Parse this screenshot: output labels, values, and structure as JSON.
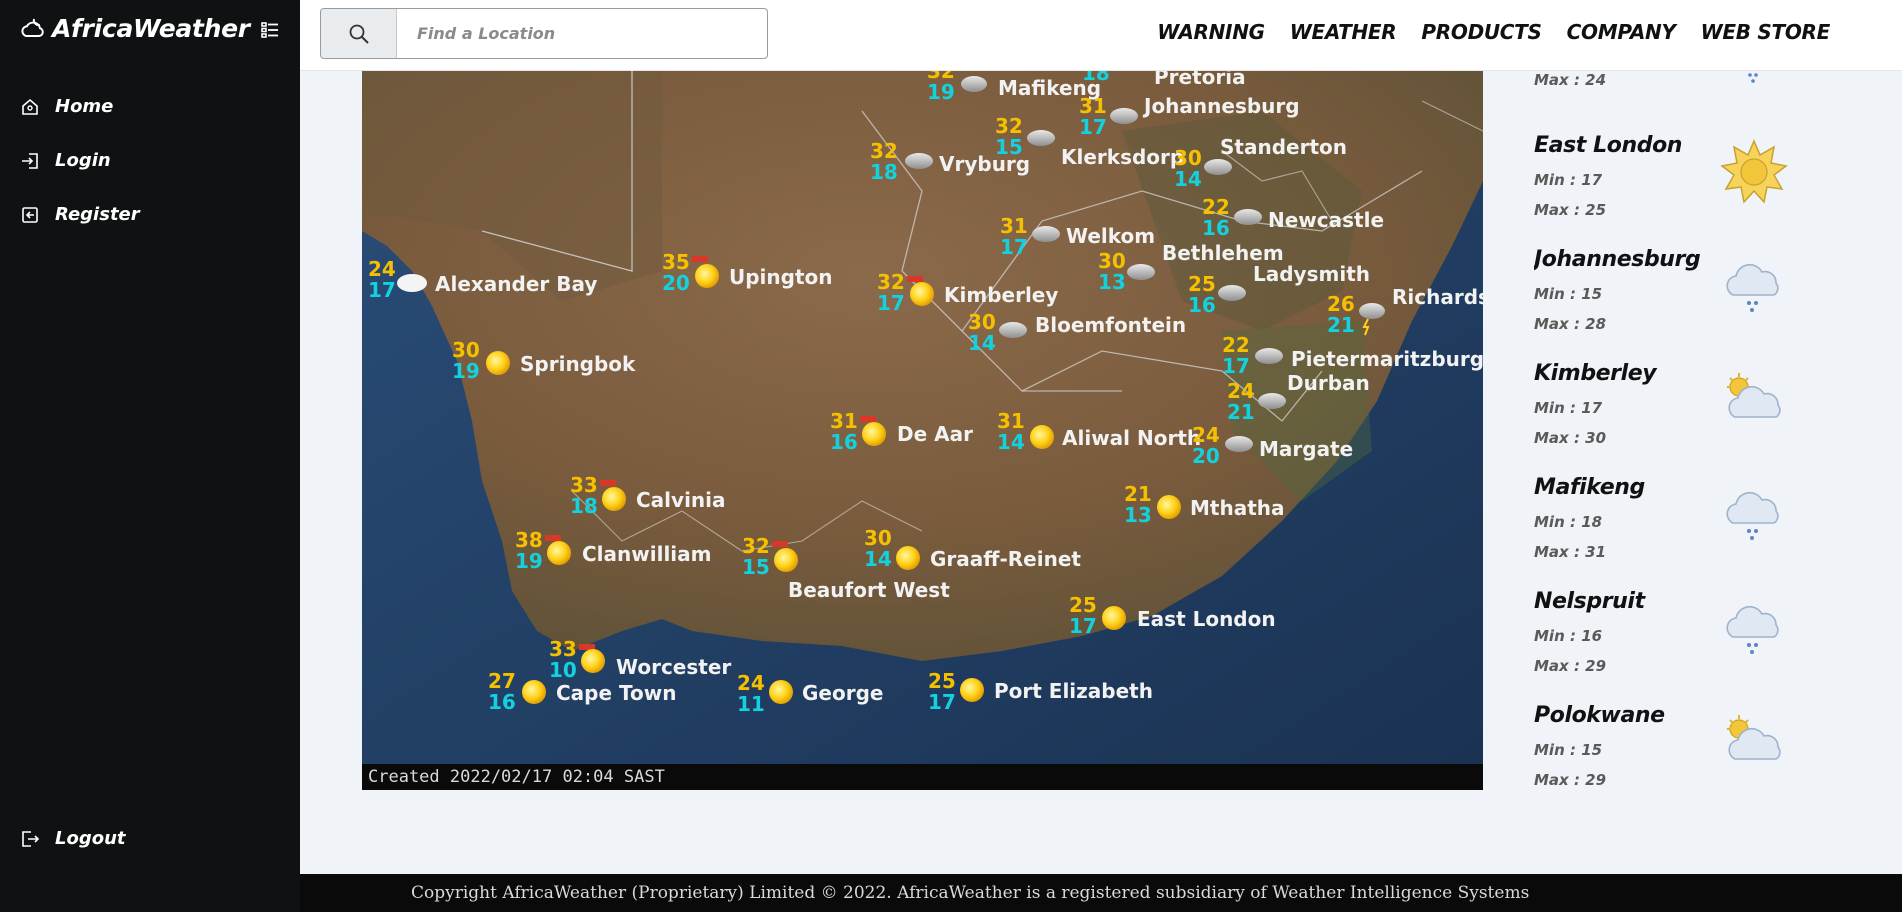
{
  "app": {
    "brand": "AfricaWeather"
  },
  "sidebar": {
    "items": [
      {
        "label": "Home",
        "icon": "home-icon"
      },
      {
        "label": "Login",
        "icon": "login-icon"
      },
      {
        "label": "Register",
        "icon": "register-icon"
      }
    ],
    "logout": {
      "label": "Logout",
      "icon": "logout-icon"
    }
  },
  "search": {
    "placeholder": "Find a Location",
    "value": ""
  },
  "topnav": [
    "WARNING",
    "WEATHER",
    "PRODUCTS",
    "COMPANY",
    "WEB STORE"
  ],
  "map": {
    "caption": "Created 2022/02/17 02:04 SAST",
    "stations": [
      {
        "name": "Mafikeng",
        "max": "32",
        "min": "19",
        "icon": "cloud-rain"
      },
      {
        "name": "Pretoria",
        "max": "",
        "min": "18",
        "icon": ""
      },
      {
        "name": "Johannesburg",
        "max": "31",
        "min": "17",
        "icon": "cloud-rain"
      },
      {
        "name": "Vryburg",
        "max": "32",
        "min": "18",
        "icon": "cloud-rain"
      },
      {
        "name": "Klerksdorp",
        "max": "32",
        "min": "15",
        "icon": "cloud-rain"
      },
      {
        "name": "Standerton",
        "max": "30",
        "min": "14",
        "icon": "cloud-rain"
      },
      {
        "name": "Newcastle",
        "max": "22",
        "min": "16",
        "icon": "cloud-rain"
      },
      {
        "name": "Welkom",
        "max": "31",
        "min": "17",
        "icon": "cloud-rain"
      },
      {
        "name": "Bethlehem",
        "max": "30",
        "min": "13",
        "icon": "cloud-rain"
      },
      {
        "name": "Ladysmith",
        "max": "25",
        "min": "16",
        "icon": "cloud-rain"
      },
      {
        "name": "Richards",
        "max": "26",
        "min": "21",
        "icon": "thunder"
      },
      {
        "name": "Alexander Bay",
        "max": "24",
        "min": "17",
        "icon": "cloud"
      },
      {
        "name": "Upington",
        "max": "35",
        "min": "20",
        "icon": "sun-hot"
      },
      {
        "name": "Kimberley",
        "max": "32",
        "min": "17",
        "icon": "sun-hot"
      },
      {
        "name": "Bloemfontein",
        "max": "30",
        "min": "14",
        "icon": "cloud-rain"
      },
      {
        "name": "Springbok",
        "max": "30",
        "min": "19",
        "icon": "sun"
      },
      {
        "name": "Pietermaritzburg",
        "max": "22",
        "min": "17",
        "icon": "cloud-rain"
      },
      {
        "name": "Durban",
        "max": "24",
        "min": "21",
        "icon": "cloud-rain"
      },
      {
        "name": "De Aar",
        "max": "31",
        "min": "16",
        "icon": "sun-hot"
      },
      {
        "name": "Aliwal North",
        "max": "31",
        "min": "14",
        "icon": "sun"
      },
      {
        "name": "Margate",
        "max": "24",
        "min": "20",
        "icon": "cloud-rain"
      },
      {
        "name": "Calvinia",
        "max": "33",
        "min": "18",
        "icon": "sun-hot"
      },
      {
        "name": "Mthatha",
        "max": "21",
        "min": "13",
        "icon": "sun"
      },
      {
        "name": "Clanwilliam",
        "max": "38",
        "min": "19",
        "icon": "sun-hot"
      },
      {
        "name": "Beaufort West",
        "max": "32",
        "min": "15",
        "icon": "sun-hot"
      },
      {
        "name": "Graaff-Reinet",
        "max": "30",
        "min": "14",
        "icon": "sun"
      },
      {
        "name": "East London",
        "max": "25",
        "min": "17",
        "icon": "sun"
      },
      {
        "name": "Worcester",
        "max": "33",
        "min": "10",
        "icon": "sun-hot"
      },
      {
        "name": "Cape Town",
        "max": "27",
        "min": "16",
        "icon": "sun"
      },
      {
        "name": "George",
        "max": "24",
        "min": "11",
        "icon": "sun"
      },
      {
        "name": "Port Elizabeth",
        "max": "25",
        "min": "17",
        "icon": "sun"
      }
    ]
  },
  "forecast": {
    "partial": {
      "max": "Max : 24",
      "icon": "drizzle-icon"
    },
    "cities": [
      {
        "name": "East London",
        "min": "Min : 17",
        "max": "Max : 25",
        "icon": "sun-icon"
      },
      {
        "name": "Johannesburg",
        "min": "Min : 15",
        "max": "Max : 28",
        "icon": "drizzle-icon"
      },
      {
        "name": "Kimberley",
        "min": "Min : 17",
        "max": "Max : 30",
        "icon": "partly-cloudy-icon"
      },
      {
        "name": "Mafikeng",
        "min": "Min : 18",
        "max": "Max : 31",
        "icon": "drizzle-icon"
      },
      {
        "name": "Nelspruit",
        "min": "Min : 16",
        "max": "Max : 29",
        "icon": "drizzle-icon"
      },
      {
        "name": "Polokwane",
        "min": "Min : 15",
        "max": "Max : 29",
        "icon": "partly-cloudy-icon"
      }
    ]
  },
  "footer": {
    "text": "Copyright AfricaWeather (Proprietary) Limited © 2022. AfricaWeather is a registered subsidiary of Weather Intelligence Systems"
  },
  "colors": {
    "sidebar": "#0f1212",
    "page": "#f0f3f7",
    "max_temp": "#f5c000",
    "min_temp": "#13d2e0"
  }
}
